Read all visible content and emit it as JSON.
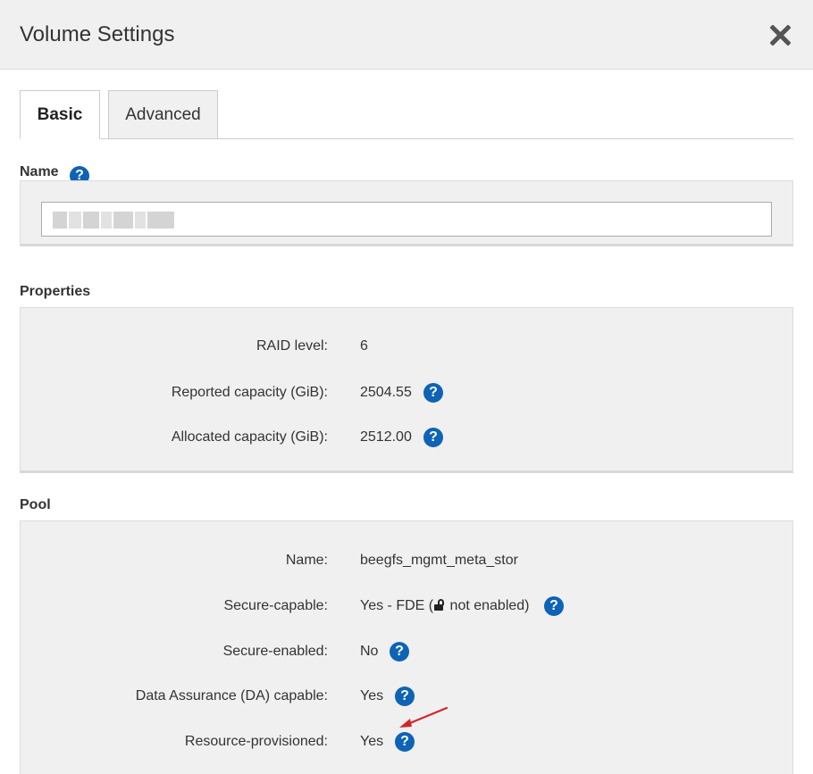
{
  "header": {
    "title": "Volume Settings",
    "close_icon": "close-icon"
  },
  "tabs": [
    {
      "label": "Basic",
      "active": true
    },
    {
      "label": "Advanced",
      "active": false
    }
  ],
  "name_section": {
    "label": "Name",
    "help_icon": "help-icon",
    "input_value": ""
  },
  "properties": {
    "label": "Properties",
    "rows": [
      {
        "label": "RAID level:",
        "value": "6",
        "help": false
      },
      {
        "label": "Reported capacity (GiB):",
        "value": "2504.55",
        "help": true
      },
      {
        "label": "Allocated capacity (GiB):",
        "value": "2512.00",
        "help": true
      }
    ]
  },
  "pool": {
    "label": "Pool",
    "rows": [
      {
        "label": "Name:",
        "value": "beegfs_mgmt_meta_stor",
        "help": false
      },
      {
        "label": "Secure-capable:",
        "value_prefix": "Yes - FDE (",
        "value_suffix": " not enabled)",
        "lock_icon": "unlocked-icon",
        "help": true
      },
      {
        "label": "Secure-enabled:",
        "value": "No",
        "help": true
      },
      {
        "label": "Data Assurance (DA) capable:",
        "value": "Yes",
        "help": true
      },
      {
        "label": "Resource-provisioned:",
        "value": "Yes",
        "help": true
      }
    ]
  },
  "help_glyph": "?",
  "colors": {
    "accent": "#0e63b4",
    "panel_bg": "#f0f0f0",
    "header_bg": "#f0f0f0",
    "annotation_arrow": "#d0262a"
  }
}
